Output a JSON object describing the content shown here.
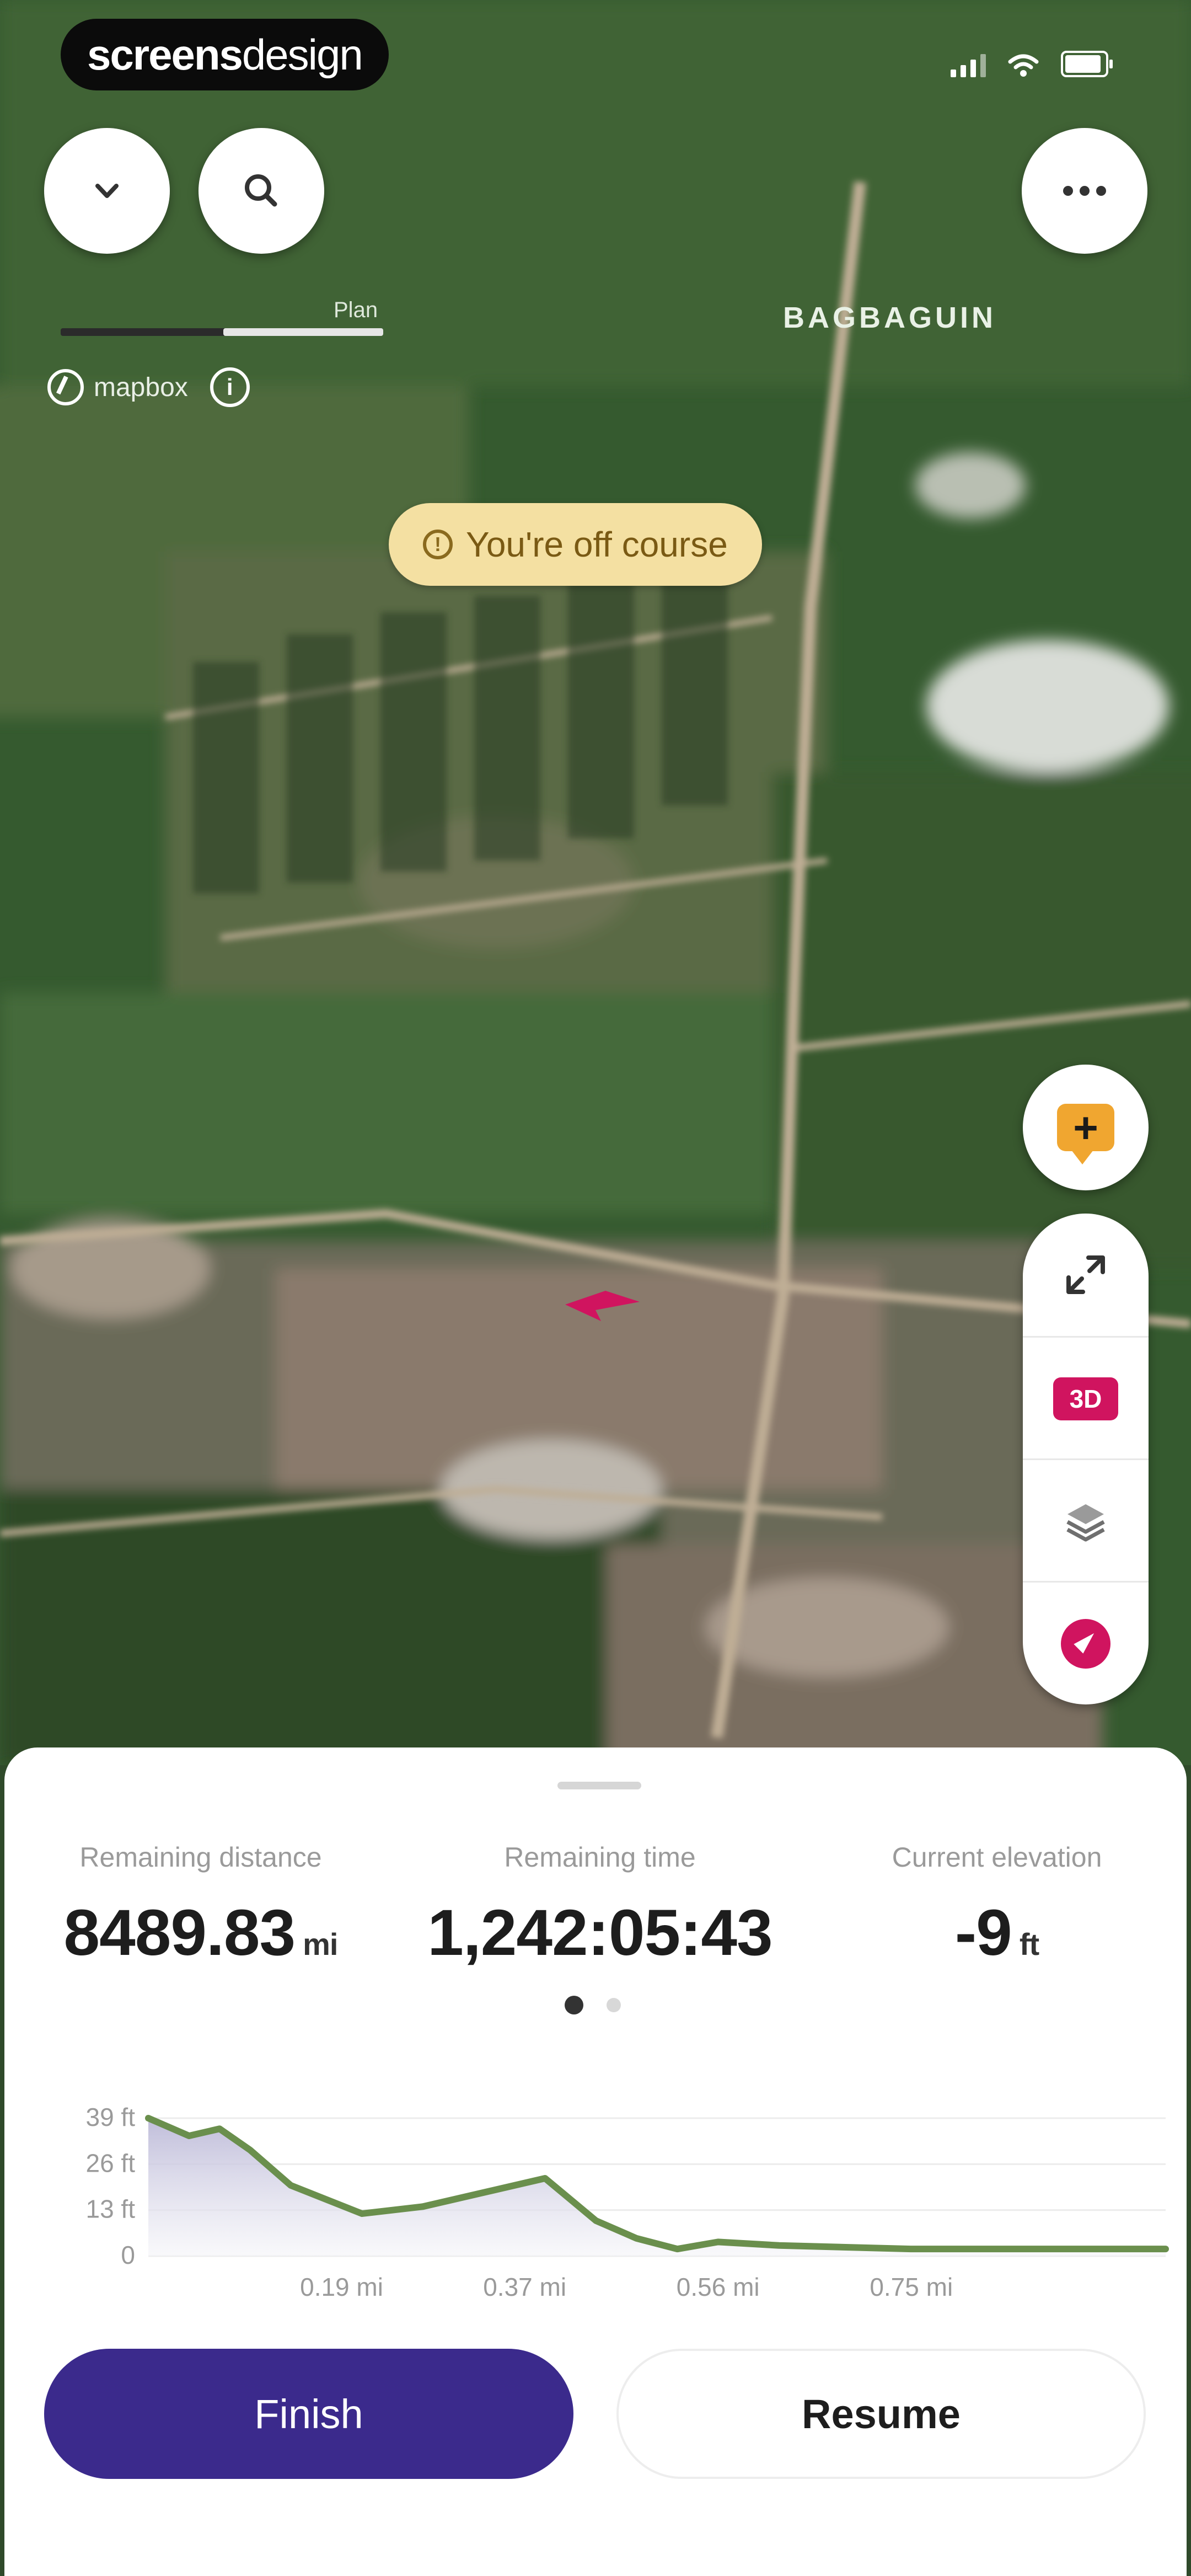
{
  "watermark": {
    "bold": "screens",
    "light": "design"
  },
  "map": {
    "scale_label": "Plan",
    "attribution": "mapbox",
    "info_label": "i",
    "place_label": "BAGBAGUIN",
    "alert_icon": "!",
    "off_course_text": "You're off course",
    "mode_3d_label": "3D"
  },
  "stats": [
    {
      "label": "Remaining distance",
      "value": "8489.83",
      "unit": "mi"
    },
    {
      "label": "Remaining time",
      "value": "1,242:05:43",
      "unit": ""
    },
    {
      "label": "Current elevation",
      "value": "-9",
      "unit": "ft"
    }
  ],
  "pager": {
    "active_index": 0,
    "count": 2
  },
  "colors": {
    "accent": "#3b2a8c",
    "marker": "#d0145f",
    "report": "#f0a630",
    "alert_bg": "#f4e0a2",
    "chart_line": "#6a8f4d"
  },
  "chart_data": {
    "type": "area",
    "x_unit": "mi",
    "y_unit": "ft",
    "x": [
      0,
      0.04,
      0.07,
      0.1,
      0.14,
      0.21,
      0.27,
      0.33,
      0.39,
      0.44,
      0.48,
      0.52,
      0.56,
      0.62,
      0.75,
      0.88,
      1.0
    ],
    "y": [
      39,
      34,
      36,
      30,
      20,
      12,
      14,
      18,
      22,
      10,
      5,
      2,
      4,
      3,
      2,
      2,
      2
    ],
    "xticks": [
      "0.19 mi",
      "0.37 mi",
      "0.56 mi",
      "0.75 mi"
    ],
    "xtick_values": [
      0.19,
      0.37,
      0.56,
      0.75
    ],
    "yticks": [
      "0",
      "13 ft",
      "26 ft",
      "39 ft"
    ],
    "ytick_values": [
      0,
      13,
      26,
      39
    ],
    "ylim": [
      0,
      39
    ],
    "xlim": [
      0,
      1.0
    ],
    "grid": true,
    "title": "",
    "xlabel": "",
    "ylabel": ""
  },
  "actions": {
    "finish_label": "Finish",
    "resume_label": "Resume"
  }
}
